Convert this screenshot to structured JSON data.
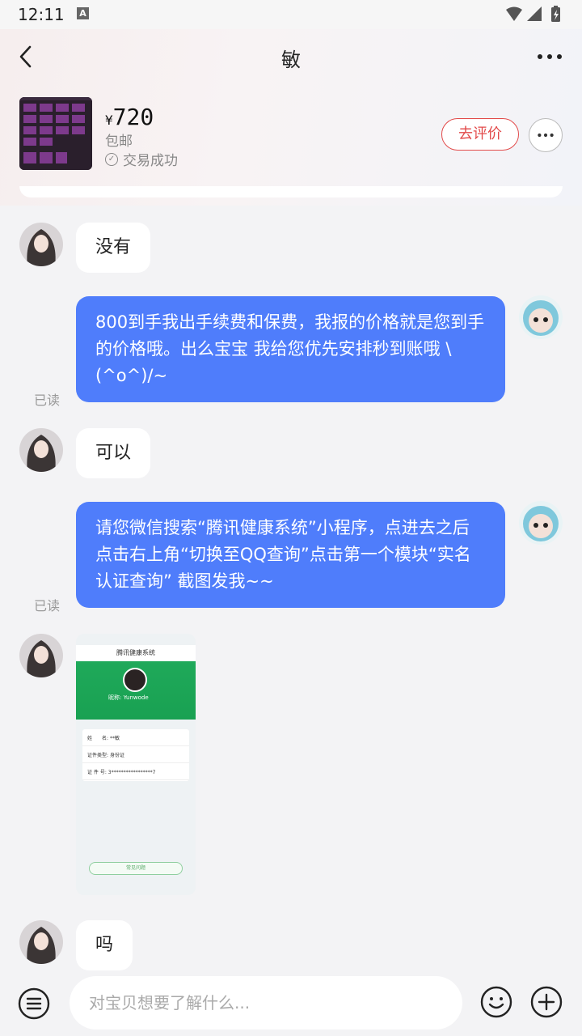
{
  "status_bar": {
    "time": "12:11",
    "notification_icon": "A"
  },
  "header": {
    "title": "敏"
  },
  "product": {
    "currency": "¥",
    "price": "720",
    "shipping": "包邮",
    "status": "交易成功",
    "review_button": "去评价"
  },
  "messages": [
    {
      "side": "left",
      "text": "没有"
    },
    {
      "side": "right",
      "text": "800到手我出手续费和保费，我报的价格就是您到手的价格哦。出么宝宝 我给您优先安排秒到账哦 \\(^o^)/~",
      "read": "已读"
    },
    {
      "side": "left",
      "text": "可以"
    },
    {
      "side": "right",
      "text": "请您微信搜索“腾讯健康系统”小程序，点进去之后点击右上角“切换至QQ查询”点击第一个模块“实名认证查询” 截图发我~~",
      "read": "已读"
    },
    {
      "side": "left",
      "type": "image",
      "image": {
        "title": "腾讯健康系统",
        "nickname": "昵称: Yunwode",
        "rows": [
          {
            "label": "姓　　名:",
            "value": "**敏"
          },
          {
            "label": "证件类型:",
            "value": "身份证"
          },
          {
            "label": "证 件 号:",
            "value": "3*****************7"
          }
        ],
        "button": "常见问题"
      }
    },
    {
      "side": "left",
      "text": "吗"
    }
  ],
  "input": {
    "placeholder": "对宝贝想要了解什么..."
  },
  "icons": {
    "back": "chevron-left-icon",
    "more": "more-dots-icon",
    "menu": "menu-icon",
    "emoji": "emoji-icon",
    "plus": "plus-icon"
  },
  "colors": {
    "bubble_right": "#4f7dfb",
    "review_accent": "#e24a4a",
    "screenshot_green": "#1fa95a"
  }
}
